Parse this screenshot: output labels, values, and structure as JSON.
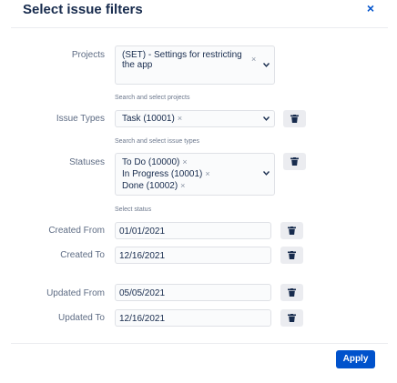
{
  "dialog": {
    "title": "Select issue filters",
    "close_icon": "×"
  },
  "projects": {
    "label": "Projects",
    "selected": [
      {
        "text_line1": "(SET) - Settings for restricting",
        "text_line2": "the app"
      }
    ],
    "remove_icon": "×",
    "help": "Search and select projects"
  },
  "issue_types": {
    "label": "Issue Types",
    "selected": [
      {
        "text": "Task (10001)"
      }
    ],
    "help": "Search and select issue types"
  },
  "statuses": {
    "label": "Statuses",
    "selected": [
      {
        "text": "To Do (10000)"
      },
      {
        "text": "In Progress (10001)"
      },
      {
        "text": "Done (10002)"
      }
    ],
    "help": "Select status"
  },
  "created_from": {
    "label": "Created From",
    "value": "01/01/2021"
  },
  "created_to": {
    "label": "Created To",
    "value": "12/16/2021"
  },
  "updated_from": {
    "label": "Updated From",
    "value": "05/05/2021"
  },
  "updated_to": {
    "label": "Updated To",
    "value": "12/16/2021"
  },
  "footer": {
    "apply_label": "Apply"
  },
  "colors": {
    "primary": "#0052cc",
    "text": "#172b4d",
    "subtle": "#5e6c84",
    "field_bg": "#fafbfc",
    "trash_bg": "#ebecf0"
  },
  "icons": {
    "close": "close-icon",
    "trash": "trash-icon",
    "chevron": "chevron-down-icon",
    "remove": "remove-tag-icon"
  }
}
